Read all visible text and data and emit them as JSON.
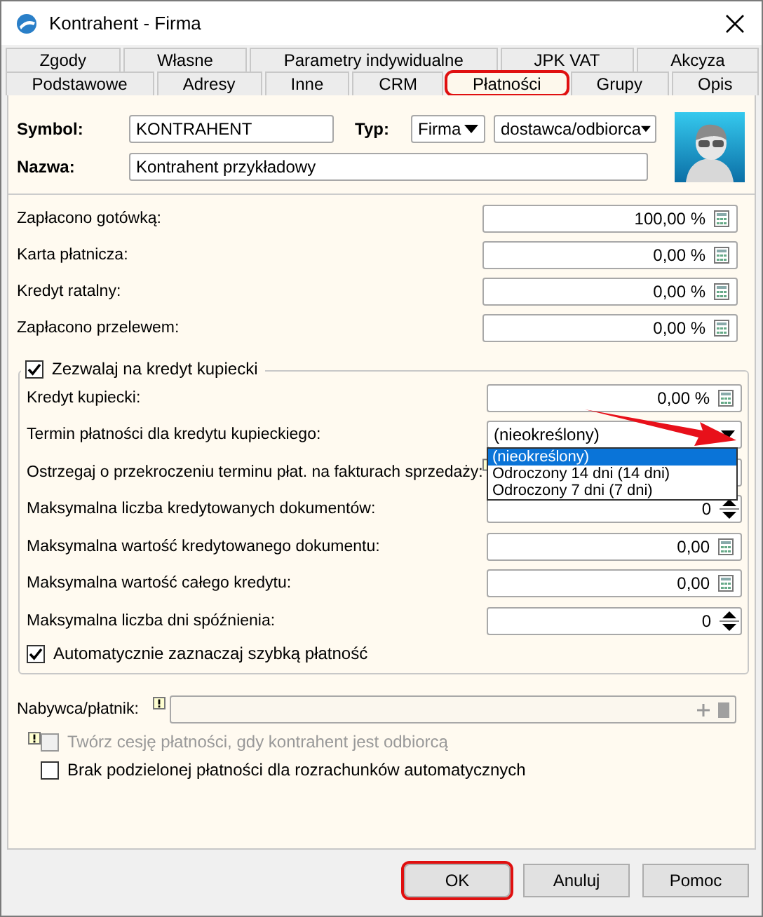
{
  "window": {
    "title": "Kontrahent - Firma"
  },
  "tab_rows": [
    {
      "tabs": [
        {
          "label": "Zgody",
          "selected": false,
          "highlighted": false
        },
        {
          "label": "Własne",
          "selected": false,
          "highlighted": false
        },
        {
          "label": "Parametry indywidualne",
          "selected": false,
          "highlighted": false
        },
        {
          "label": "JPK VAT",
          "selected": false,
          "highlighted": false
        },
        {
          "label": "Akcyza",
          "selected": false,
          "highlighted": false
        }
      ]
    },
    {
      "tabs": [
        {
          "label": "Podstawowe",
          "selected": false,
          "highlighted": false
        },
        {
          "label": "Adresy",
          "selected": false,
          "highlighted": false
        },
        {
          "label": "Inne",
          "selected": false,
          "highlighted": false
        },
        {
          "label": "CRM",
          "selected": false,
          "highlighted": false
        },
        {
          "label": "Płatności",
          "selected": true,
          "highlighted": true
        },
        {
          "label": "Grupy",
          "selected": false,
          "highlighted": false
        },
        {
          "label": "Opis",
          "selected": false,
          "highlighted": false
        }
      ]
    }
  ],
  "header": {
    "symbol_label": "Symbol:",
    "symbol_value": "KONTRAHENT",
    "type_label": "Typ:",
    "type_value": "Firma",
    "role_value": "dostawca/odbiorca",
    "name_label": "Nazwa:",
    "name_value": "Kontrahent przykładowy"
  },
  "payment_rows": [
    {
      "kind": "calc",
      "label": "Zapłacono gotówką:",
      "value": "100,00 %"
    },
    {
      "kind": "calc",
      "label": "Karta płatnicza:",
      "value": "0,00 %"
    },
    {
      "kind": "calc",
      "label": "Kredyt ratalny:",
      "value": "0,00 %"
    },
    {
      "kind": "calc",
      "label": "Zapłacono przelewem:",
      "value": "0,00 %"
    }
  ],
  "merchant_credit": {
    "label": "Zezwalaj na kredyt kupiecki",
    "checked": true,
    "rows": [
      {
        "kind": "calc",
        "label": "Kredyt kupiecki:",
        "value": "0,00 %"
      },
      {
        "kind": "select",
        "label": "Termin płatności dla kredytu kupieckiego:",
        "value": "(nieokreślony)"
      },
      {
        "kind": "warning",
        "label": "Ostrzegaj o przekroczeniu terminu płat. na fakturach sprzedaży:"
      },
      {
        "kind": "spin",
        "label": "Maksymalna liczba kredytowanych dokumentów:",
        "value": "0"
      },
      {
        "kind": "calc",
        "label": "Maksymalna wartość kredytowanego dokumentu:",
        "value": "0,00"
      },
      {
        "kind": "calc",
        "label": "Maksymalna wartość całego kredytu:",
        "value": "0,00"
      },
      {
        "kind": "spin",
        "label": "Maksymalna liczba dni spóźnienia:",
        "value": "0"
      }
    ],
    "dropdown": {
      "open": true,
      "options": [
        {
          "label": "(nieokreślony)",
          "selected": true
        },
        {
          "label": "Odroczony 14 dni (14 dni)",
          "selected": false
        },
        {
          "label": "Odroczony 7 dni (7 dni)",
          "selected": false
        }
      ]
    },
    "auto_quick": {
      "label": "Automatycznie zaznaczaj szybką płatność",
      "checked": true
    }
  },
  "payer": {
    "label": "Nabywca/płatnik:"
  },
  "options": [
    {
      "label": "Twórz cesję płatności, gdy kontrahent jest odbiorcą",
      "checked": false,
      "disabled": true,
      "warning": true
    },
    {
      "label": "Brak podzielonej płatności dla rozrachunków automatycznych",
      "checked": false,
      "disabled": false,
      "warning": false
    }
  ],
  "buttons": [
    {
      "label": "OK",
      "highlighted": true
    },
    {
      "label": "Anuluj",
      "highlighted": false
    },
    {
      "label": "Pomoc",
      "highlighted": false
    }
  ]
}
